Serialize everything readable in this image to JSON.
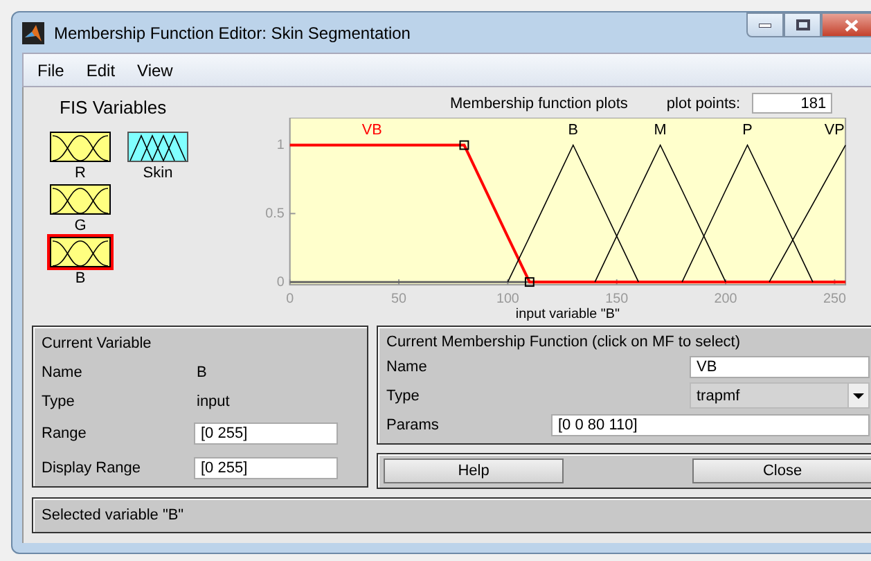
{
  "window": {
    "title": "Membership Function Editor: Skin Segmentation"
  },
  "menu": [
    "File",
    "Edit",
    "View"
  ],
  "fis_variables": {
    "title": "FIS Variables",
    "items": [
      {
        "name": "R",
        "kind": "input",
        "selected": false
      },
      {
        "name": "G",
        "kind": "input",
        "selected": false
      },
      {
        "name": "B",
        "kind": "input",
        "selected": true
      },
      {
        "name": "Skin",
        "kind": "output",
        "selected": false
      }
    ]
  },
  "plot": {
    "title": "Membership function plots",
    "plot_points_label": "plot points:",
    "plot_points": "181",
    "chart_data": {
      "type": "line",
      "xlabel": "input variable \"B\"",
      "x": [
        0,
        80,
        100,
        110,
        130,
        140,
        160,
        170,
        180,
        200,
        210,
        220,
        240,
        255
      ],
      "series": [
        {
          "name": "VB",
          "color": "#ff0000",
          "values": [
            1,
            1,
            0.33,
            0,
            0,
            0,
            0,
            0,
            0,
            0,
            0,
            0,
            0,
            0
          ]
        },
        {
          "name": "B",
          "color": "#000000",
          "values": [
            null,
            null,
            0,
            0.33,
            1,
            0.67,
            0,
            null,
            null,
            null,
            null,
            null,
            null,
            null
          ]
        },
        {
          "name": "M",
          "color": "#000000",
          "values": [
            null,
            null,
            null,
            null,
            null,
            0,
            0.67,
            1,
            0.67,
            0,
            null,
            null,
            null,
            null
          ]
        },
        {
          "name": "P",
          "color": "#000000",
          "values": [
            null,
            null,
            null,
            null,
            null,
            null,
            null,
            null,
            0,
            0.67,
            1,
            0.67,
            0,
            null
          ]
        },
        {
          "name": "VP",
          "color": "#000000",
          "values": [
            null,
            null,
            null,
            null,
            null,
            null,
            null,
            null,
            null,
            null,
            null,
            0,
            0.57,
            1
          ]
        }
      ],
      "xlim": [
        0,
        255
      ],
      "ylim": [
        -0.02,
        1.2
      ],
      "xticks": [
        0,
        50,
        100,
        150,
        200,
        250
      ],
      "yticks": [
        0,
        {
          "value": 0.5,
          "label": "0.5"
        },
        1
      ]
    },
    "mf_states": [
      {
        "selected": true
      },
      {
        "selected": false
      },
      {
        "selected": false
      },
      {
        "selected": false
      },
      {
        "selected": false
      }
    ]
  },
  "current_variable": {
    "title": "Current Variable",
    "name_label": "Name",
    "name": "B",
    "type_label": "Type",
    "type": "input",
    "range_label": "Range",
    "range": "[0 255]",
    "display_range_label": "Display Range",
    "display_range": "[0 255]"
  },
  "current_mf": {
    "title": "Current Membership Function (click on MF to select)",
    "name_label": "Name",
    "name": "VB",
    "type_label": "Type",
    "type": "trapmf",
    "params_label": "Params",
    "params": "[0 0 80 110]"
  },
  "buttons": [
    "Help",
    "Close"
  ],
  "status": "Selected variable \"B\""
}
